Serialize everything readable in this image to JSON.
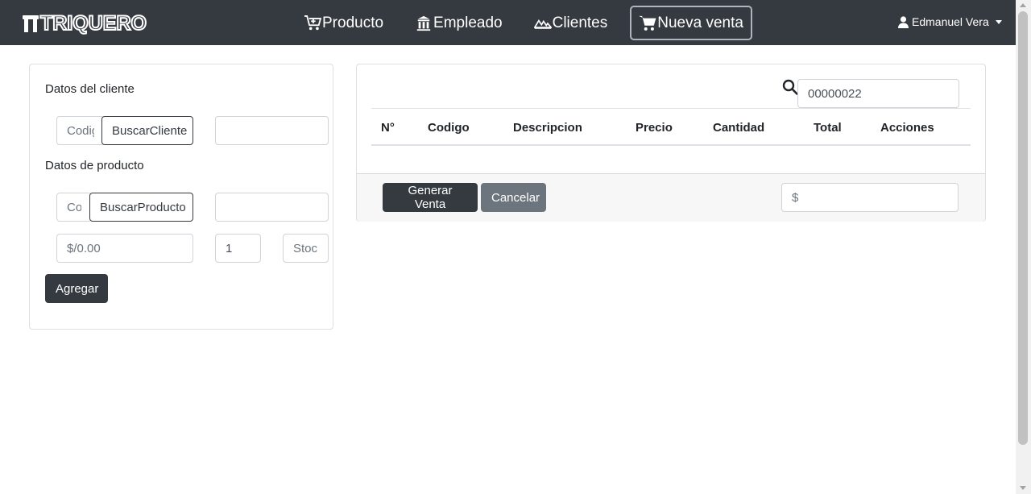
{
  "brand": {
    "name": "TRIQUERO"
  },
  "nav": {
    "items": [
      {
        "label": "Producto",
        "icon": "cart-plus-icon"
      },
      {
        "label": "Empleado",
        "icon": "building-icon"
      },
      {
        "label": "Clientes",
        "icon": "users-icon"
      },
      {
        "label": "Nueva venta",
        "icon": "cart-icon",
        "active": true
      }
    ],
    "user": {
      "label": "Edmanuel Vera",
      "icon": "user-icon"
    }
  },
  "form": {
    "cliente_title": "Datos del cliente",
    "cliente_codigo_placeholder": "Codigo",
    "buscar_cliente_label": "BuscarCliente",
    "cliente_nombre_value": "",
    "producto_title": "Datos de producto",
    "producto_codigo_placeholder": "Codigo",
    "buscar_producto_label": "BuscarProducto",
    "producto_nombre_value": "",
    "precio_placeholder": "$/0.00",
    "cantidad_value": "1",
    "stock_placeholder": "Stock",
    "agregar_label": "Agregar"
  },
  "sale": {
    "numero_serie": "00000022",
    "columns": [
      "N°",
      "Codigo",
      "Descripcion",
      "Precio",
      "Cantidad",
      "Total",
      "Acciones"
    ],
    "rows": [],
    "generar_label": "Generar Venta",
    "cancelar_label": "Cancelar",
    "total_placeholder": "$"
  },
  "colors": {
    "navbar": "#343a40",
    "dark_button": "#343a40",
    "secondary_button": "#6c757d"
  }
}
